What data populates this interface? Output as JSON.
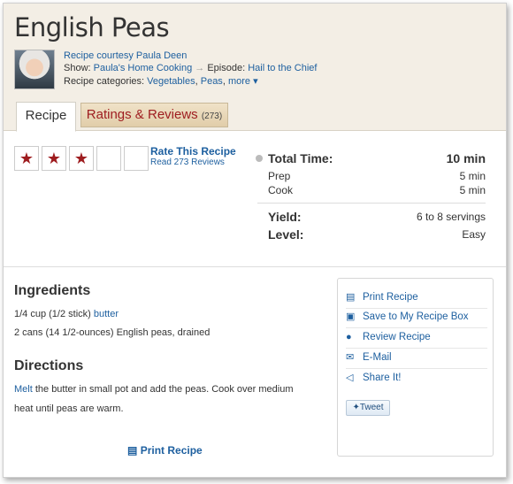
{
  "recipe": {
    "title": "English Peas",
    "courtesy": "Recipe courtesy Paula Deen",
    "show_label": "Show:",
    "show_name": "Paula's Home Cooking",
    "episode_label": "Episode:",
    "episode_name": "Hail to the Chief",
    "categories_label": "Recipe categories:",
    "category_1": "Vegetables",
    "category_2": "Peas",
    "more_label": "more",
    "chevron": "▾"
  },
  "tabs": {
    "recipe": "Recipe",
    "reviews": "Ratings & Reviews",
    "reviews_count": "(273)"
  },
  "rating": {
    "stars_filled": 3,
    "stars_total": 5,
    "rate_label": "Rate This Recipe",
    "read_label": "Read 273 Reviews"
  },
  "time": {
    "total_label": "Total Time:",
    "total_value": "10 min",
    "prep_label": "Prep",
    "prep_value": "5 min",
    "cook_label": "Cook",
    "cook_value": "5 min",
    "yield_label": "Yield:",
    "yield_value": "6 to 8 servings",
    "level_label": "Level:",
    "level_value": "Easy"
  },
  "ingredients": {
    "heading": "Ingredients",
    "item1_prefix": "1/4 cup (1/2 stick)",
    "item1_link": "butter",
    "item2": "2 cans (14 1/2-ounces) English peas, drained"
  },
  "directions": {
    "heading": "Directions",
    "link": "Melt",
    "line1_rest": "the butter in small pot and add the peas. Cook over medium",
    "line2": "heat until peas are warm."
  },
  "sidebar": {
    "items": [
      {
        "label": "Print Recipe",
        "icon": "print-icon"
      },
      {
        "label": "Save to My Recipe Box",
        "icon": "recipe-box-icon"
      },
      {
        "label": "Review Recipe",
        "icon": "speech-bubble-icon"
      },
      {
        "label": "E-Mail",
        "icon": "email-icon"
      },
      {
        "label": "Share It!",
        "icon": "share-icon"
      }
    ],
    "tweet": "Tweet"
  },
  "footer": {
    "print_label": "Print Recipe"
  },
  "colors": {
    "link": "#1d5f9f",
    "accent_red": "#9e1c1f",
    "header_bg": "#f3eee5"
  }
}
